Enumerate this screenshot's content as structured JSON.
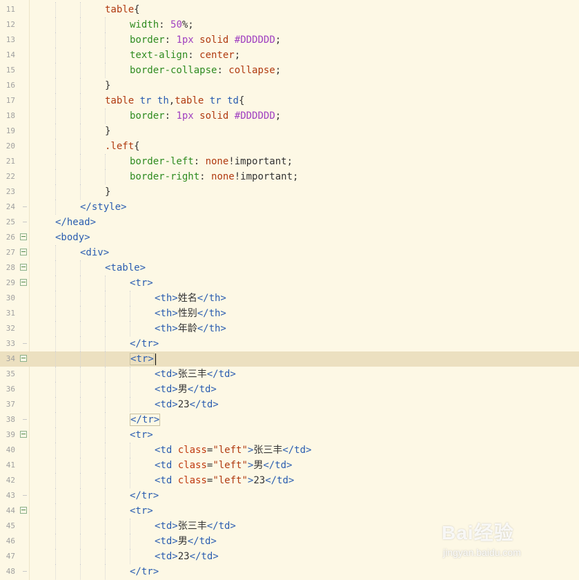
{
  "editor": {
    "current_line": 34,
    "lines": [
      {
        "n": 11,
        "indent": 3,
        "fold": "",
        "tokens": [
          [
            "sel",
            "table"
          ],
          [
            "plain",
            "{"
          ]
        ]
      },
      {
        "n": 12,
        "indent": 4,
        "fold": "",
        "tokens": [
          [
            "prop",
            "width"
          ],
          [
            "plain",
            ": "
          ],
          [
            "num",
            "50"
          ],
          [
            "plain",
            "%;"
          ]
        ]
      },
      {
        "n": 13,
        "indent": 4,
        "fold": "",
        "tokens": [
          [
            "prop",
            "border"
          ],
          [
            "plain",
            ": "
          ],
          [
            "num",
            "1px"
          ],
          [
            "plain",
            " "
          ],
          [
            "val",
            "solid"
          ],
          [
            "plain",
            " "
          ],
          [
            "hex",
            "#DDDDDD"
          ],
          [
            "plain",
            ";"
          ]
        ]
      },
      {
        "n": 14,
        "indent": 4,
        "fold": "",
        "tokens": [
          [
            "prop",
            "text-align"
          ],
          [
            "plain",
            ": "
          ],
          [
            "val",
            "center"
          ],
          [
            "plain",
            ";"
          ]
        ]
      },
      {
        "n": 15,
        "indent": 4,
        "fold": "",
        "tokens": [
          [
            "prop",
            "border-collapse"
          ],
          [
            "plain",
            ": "
          ],
          [
            "val",
            "collapse"
          ],
          [
            "plain",
            ";"
          ]
        ]
      },
      {
        "n": 16,
        "indent": 3,
        "fold": "",
        "tokens": [
          [
            "plain",
            "}"
          ]
        ]
      },
      {
        "n": 17,
        "indent": 3,
        "fold": "",
        "tokens": [
          [
            "sel",
            "table"
          ],
          [
            "plain",
            " "
          ],
          [
            "tag",
            "tr"
          ],
          [
            "plain",
            " "
          ],
          [
            "tag",
            "th"
          ],
          [
            "plain",
            ","
          ],
          [
            "sel",
            "table"
          ],
          [
            "plain",
            " "
          ],
          [
            "tag",
            "tr"
          ],
          [
            "plain",
            " "
          ],
          [
            "tag",
            "td"
          ],
          [
            "plain",
            "{"
          ]
        ]
      },
      {
        "n": 18,
        "indent": 4,
        "fold": "",
        "tokens": [
          [
            "prop",
            "border"
          ],
          [
            "plain",
            ": "
          ],
          [
            "num",
            "1px"
          ],
          [
            "plain",
            " "
          ],
          [
            "val",
            "solid"
          ],
          [
            "plain",
            " "
          ],
          [
            "hex",
            "#DDDDDD"
          ],
          [
            "plain",
            ";"
          ]
        ]
      },
      {
        "n": 19,
        "indent": 3,
        "fold": "",
        "tokens": [
          [
            "plain",
            "}"
          ]
        ]
      },
      {
        "n": 20,
        "indent": 3,
        "fold": "",
        "tokens": [
          [
            "sel",
            ".left"
          ],
          [
            "plain",
            "{"
          ]
        ]
      },
      {
        "n": 21,
        "indent": 4,
        "fold": "",
        "tokens": [
          [
            "prop",
            "border-left"
          ],
          [
            "plain",
            ": "
          ],
          [
            "val",
            "none"
          ],
          [
            "plain",
            "!important;"
          ]
        ]
      },
      {
        "n": 22,
        "indent": 4,
        "fold": "",
        "tokens": [
          [
            "prop",
            "border-right"
          ],
          [
            "plain",
            ": "
          ],
          [
            "val",
            "none"
          ],
          [
            "plain",
            "!important;"
          ]
        ]
      },
      {
        "n": 23,
        "indent": 3,
        "fold": "",
        "tokens": [
          [
            "plain",
            "}"
          ]
        ]
      },
      {
        "n": 24,
        "indent": 2,
        "fold": "end",
        "tokens": [
          [
            "tag",
            "</style>"
          ]
        ]
      },
      {
        "n": 25,
        "indent": 1,
        "fold": "end",
        "tokens": [
          [
            "tag",
            "</head>"
          ]
        ]
      },
      {
        "n": 26,
        "indent": 1,
        "fold": "open",
        "tokens": [
          [
            "tag",
            "<body>"
          ]
        ]
      },
      {
        "n": 27,
        "indent": 2,
        "fold": "open",
        "tokens": [
          [
            "tag",
            "<div>"
          ]
        ]
      },
      {
        "n": 28,
        "indent": 3,
        "fold": "open",
        "tokens": [
          [
            "tag",
            "<table>"
          ]
        ]
      },
      {
        "n": 29,
        "indent": 4,
        "fold": "open",
        "tokens": [
          [
            "tag",
            "<tr>"
          ]
        ]
      },
      {
        "n": 30,
        "indent": 5,
        "fold": "",
        "tokens": [
          [
            "tag",
            "<th>"
          ],
          [
            "plain",
            "姓名"
          ],
          [
            "tag",
            "</th>"
          ]
        ]
      },
      {
        "n": 31,
        "indent": 5,
        "fold": "",
        "tokens": [
          [
            "tag",
            "<th>"
          ],
          [
            "plain",
            "性别"
          ],
          [
            "tag",
            "</th>"
          ]
        ]
      },
      {
        "n": 32,
        "indent": 5,
        "fold": "",
        "tokens": [
          [
            "tag",
            "<th>"
          ],
          [
            "plain",
            "年龄"
          ],
          [
            "tag",
            "</th>"
          ]
        ]
      },
      {
        "n": 33,
        "indent": 4,
        "fold": "end",
        "tokens": [
          [
            "tag",
            "</tr>"
          ]
        ]
      },
      {
        "n": 34,
        "indent": 4,
        "fold": "open",
        "tokens": [
          [
            "tagbox",
            "<tr>"
          ],
          [
            "caret",
            ""
          ]
        ]
      },
      {
        "n": 35,
        "indent": 5,
        "fold": "",
        "tokens": [
          [
            "tag",
            "<td>"
          ],
          [
            "plain",
            "张三丰"
          ],
          [
            "tag",
            "</td>"
          ]
        ]
      },
      {
        "n": 36,
        "indent": 5,
        "fold": "",
        "tokens": [
          [
            "tag",
            "<td>"
          ],
          [
            "plain",
            "男"
          ],
          [
            "tag",
            "</td>"
          ]
        ]
      },
      {
        "n": 37,
        "indent": 5,
        "fold": "",
        "tokens": [
          [
            "tag",
            "<td>"
          ],
          [
            "plain",
            "23"
          ],
          [
            "tag",
            "</td>"
          ]
        ]
      },
      {
        "n": 38,
        "indent": 4,
        "fold": "end",
        "tokens": [
          [
            "tagbox",
            "</tr>"
          ]
        ]
      },
      {
        "n": 39,
        "indent": 4,
        "fold": "open",
        "tokens": [
          [
            "tag",
            "<tr>"
          ]
        ]
      },
      {
        "n": 40,
        "indent": 5,
        "fold": "",
        "tokens": [
          [
            "tag",
            "<td "
          ],
          [
            "attr",
            "class"
          ],
          [
            "plain",
            "="
          ],
          [
            "str",
            "\"left\""
          ],
          [
            "tag",
            ">"
          ],
          [
            "plain",
            "张三丰"
          ],
          [
            "tag",
            "</td>"
          ]
        ]
      },
      {
        "n": 41,
        "indent": 5,
        "fold": "",
        "tokens": [
          [
            "tag",
            "<td "
          ],
          [
            "attr",
            "class"
          ],
          [
            "plain",
            "="
          ],
          [
            "str",
            "\"left\""
          ],
          [
            "tag",
            ">"
          ],
          [
            "plain",
            "男"
          ],
          [
            "tag",
            "</td>"
          ]
        ]
      },
      {
        "n": 42,
        "indent": 5,
        "fold": "",
        "tokens": [
          [
            "tag",
            "<td "
          ],
          [
            "attr",
            "class"
          ],
          [
            "plain",
            "="
          ],
          [
            "str",
            "\"left\""
          ],
          [
            "tag",
            ">"
          ],
          [
            "plain",
            "23"
          ],
          [
            "tag",
            "</td>"
          ]
        ]
      },
      {
        "n": 43,
        "indent": 4,
        "fold": "end",
        "tokens": [
          [
            "tag",
            "</tr>"
          ]
        ]
      },
      {
        "n": 44,
        "indent": 4,
        "fold": "open",
        "tokens": [
          [
            "tag",
            "<tr>"
          ]
        ]
      },
      {
        "n": 45,
        "indent": 5,
        "fold": "",
        "tokens": [
          [
            "tag",
            "<td>"
          ],
          [
            "plain",
            "张三丰"
          ],
          [
            "tag",
            "</td>"
          ]
        ]
      },
      {
        "n": 46,
        "indent": 5,
        "fold": "",
        "tokens": [
          [
            "tag",
            "<td>"
          ],
          [
            "plain",
            "男"
          ],
          [
            "tag",
            "</td>"
          ]
        ]
      },
      {
        "n": 47,
        "indent": 5,
        "fold": "",
        "tokens": [
          [
            "tag",
            "<td>"
          ],
          [
            "plain",
            "23"
          ],
          [
            "tag",
            "</td>"
          ]
        ]
      },
      {
        "n": 48,
        "indent": 4,
        "fold": "end",
        "tokens": [
          [
            "tag",
            "</tr>"
          ]
        ]
      }
    ]
  },
  "watermark": {
    "brand": "Bai经验",
    "url": "jingyan.baidu.com"
  },
  "colors": {
    "background": "#FDF8E5",
    "current_line": "#ECE0C0",
    "tag": "#2A5DB0",
    "selector": "#B03A10",
    "property": "#2E8B20",
    "number": "#A040C0"
  }
}
